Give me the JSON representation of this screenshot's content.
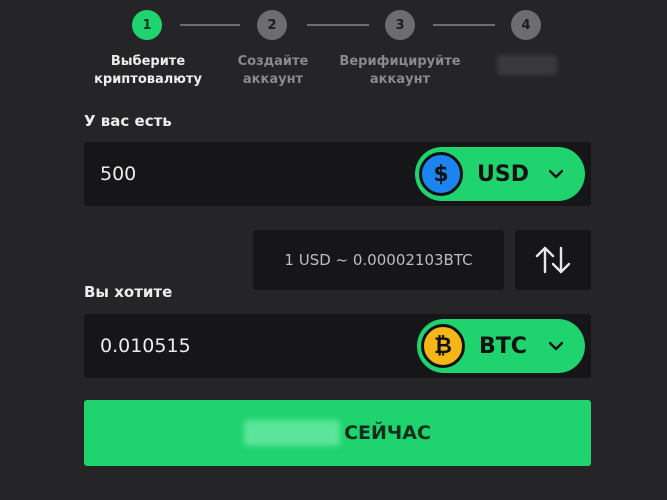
{
  "stepper": {
    "steps": [
      {
        "number": "1",
        "label_line1": "Выберите",
        "label_line2": "криптовалюту",
        "active": true
      },
      {
        "number": "2",
        "label_line1": "Создайте",
        "label_line2": "аккаунт",
        "active": false
      },
      {
        "number": "3",
        "label_line1": "Верифицируйте",
        "label_line2": "аккаунт",
        "active": false
      },
      {
        "number": "4",
        "label_line1": "",
        "label_line2": "",
        "active": false
      }
    ]
  },
  "have": {
    "label": "У вас есть",
    "amount": "500",
    "currency": "USD",
    "coin_symbol": "$",
    "coin_icon": "dollar-coin-icon"
  },
  "rate": {
    "text": "1 USD ~ 0.00002103BTC"
  },
  "swap": {
    "icon": "swap-arrows-icon"
  },
  "want": {
    "label": "Вы хотите",
    "amount": "0.010515",
    "currency": "BTC",
    "coin_symbol": "₿",
    "coin_icon": "bitcoin-coin-icon"
  },
  "cta": {
    "label": "СЕЙЧАС"
  },
  "colors": {
    "background": "#252527",
    "field_bg": "#161618",
    "accent_green": "#1fd36e",
    "usd_blue": "#1c84f0",
    "btc_gold": "#f5b618"
  }
}
